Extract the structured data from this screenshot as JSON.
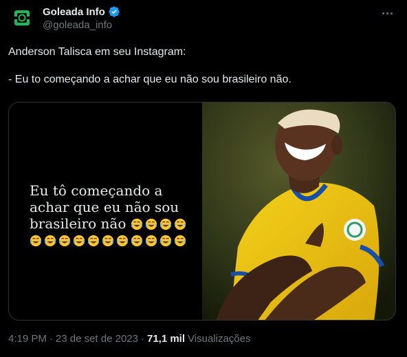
{
  "author": {
    "display_name": "Goleada Info",
    "handle": "@goleada_info",
    "verified": true,
    "avatar_icon": "goleada-logo-icon"
  },
  "tweet": {
    "line1": "Anderson Talisca em seu Instagram:",
    "line2": "- Eu to começando a achar que eu não sou brasileiro não."
  },
  "media": {
    "story_text": "Eu tô começando a achar que eu não sou brasileiro não",
    "laugh_emoji_count": 15,
    "photo_description_icon": "player-photo"
  },
  "meta": {
    "time": "4:19 PM",
    "separator": "·",
    "date": "23 de set de 2023",
    "views_count": "71,1 mil",
    "views_label": "Visualizações"
  },
  "colors": {
    "background": "#000000",
    "text": "#e7e9ea",
    "secondary": "#71767b",
    "verified": "#1d9bf0",
    "brand": "#1db954"
  }
}
